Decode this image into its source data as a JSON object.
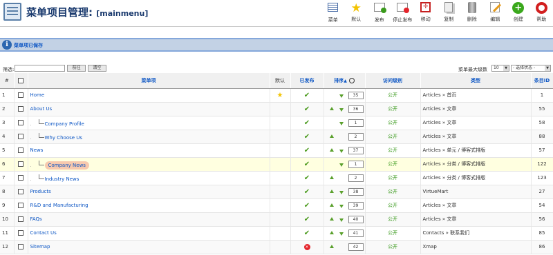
{
  "header": {
    "title": "菜单项目管理:",
    "menu_name": "[mainmenu]"
  },
  "toolbar": [
    {
      "name": "menu-button",
      "label": "菜单",
      "icon": "menu-icon",
      "color": "#4a6ea8"
    },
    {
      "name": "default-button",
      "label": "默认",
      "icon": "star-icon",
      "color": "#f3c300"
    },
    {
      "name": "publish-button",
      "label": "发布",
      "icon": "publish-icon",
      "color": "#3a9a1c"
    },
    {
      "name": "unpublish-button",
      "label": "停止发布",
      "icon": "unpublish-icon",
      "color": "#e4242b"
    },
    {
      "name": "move-button",
      "label": "移动",
      "icon": "move-icon",
      "color": "#c62020"
    },
    {
      "name": "copy-button",
      "label": "复制",
      "icon": "copy-icon",
      "color": "#888888"
    },
    {
      "name": "trash-button",
      "label": "删除",
      "icon": "trash-icon",
      "color": "#666666"
    },
    {
      "name": "edit-button",
      "label": "编辑",
      "icon": "edit-icon",
      "color": "#e59a1a"
    },
    {
      "name": "new-button",
      "label": "创建",
      "icon": "new-icon",
      "color": "#3aa81c"
    },
    {
      "name": "help-button",
      "label": "帮助",
      "icon": "help-icon",
      "color": "#d21f1f"
    }
  ],
  "message": {
    "text": "菜单项已保存"
  },
  "filter": {
    "label": "筛选:",
    "value": "",
    "go_label": "前往",
    "reset_label": "清空",
    "max_levels_label": "菜单最大级数",
    "max_levels_value": "10",
    "state_value": "- 选择状态 -"
  },
  "columns": {
    "num": "#",
    "title": "菜单项",
    "default": "默认",
    "published": "已发布",
    "order": "排序",
    "access": "访问级别",
    "type": "类型",
    "id": "条目ID"
  },
  "rows": [
    {
      "num": "1",
      "title": "Home",
      "level": 0,
      "default": true,
      "published": true,
      "order": "35",
      "up": false,
      "down": true,
      "access": "公开",
      "type": "Articles » 首页",
      "id": "1"
    },
    {
      "num": "2",
      "title": "About Us",
      "level": 0,
      "default": false,
      "published": true,
      "order": "36",
      "up": true,
      "down": true,
      "access": "公开",
      "type": "Articles » 文章",
      "id": "55"
    },
    {
      "num": "3",
      "title": "Company Profile",
      "level": 1,
      "default": false,
      "published": true,
      "order": "1",
      "up": false,
      "down": true,
      "access": "公开",
      "type": "Articles » 文章",
      "id": "58"
    },
    {
      "num": "4",
      "title": "Why Choose Us",
      "level": 1,
      "default": false,
      "published": true,
      "order": "2",
      "up": true,
      "down": false,
      "access": "公开",
      "type": "Articles » 文章",
      "id": "88"
    },
    {
      "num": "5",
      "title": "News",
      "level": 0,
      "default": false,
      "published": true,
      "order": "37",
      "up": true,
      "down": true,
      "access": "公开",
      "type": "Articles » 单元 / 博客式排版",
      "id": "57"
    },
    {
      "num": "6",
      "title": "Company News",
      "level": 1,
      "default": false,
      "published": true,
      "order": "1",
      "up": false,
      "down": true,
      "access": "公开",
      "type": "Articles » 分类 / 博客式排版",
      "id": "122",
      "highlight": true
    },
    {
      "num": "7",
      "title": "Industry News",
      "level": 1,
      "default": false,
      "published": true,
      "order": "2",
      "up": true,
      "down": false,
      "access": "公开",
      "type": "Articles » 分类 / 博客式排版",
      "id": "123"
    },
    {
      "num": "8",
      "title": "Products",
      "level": 0,
      "default": false,
      "published": true,
      "order": "38",
      "up": true,
      "down": true,
      "access": "公开",
      "type": "VirtueMart",
      "id": "27"
    },
    {
      "num": "9",
      "title": "R&D and Manufacturing",
      "level": 0,
      "default": false,
      "published": true,
      "order": "39",
      "up": true,
      "down": true,
      "access": "公开",
      "type": "Articles » 文章",
      "id": "54"
    },
    {
      "num": "10",
      "title": "FAQs",
      "level": 0,
      "default": false,
      "published": true,
      "order": "40",
      "up": true,
      "down": true,
      "access": "公开",
      "type": "Articles » 文章",
      "id": "56"
    },
    {
      "num": "11",
      "title": "Contact Us",
      "level": 0,
      "default": false,
      "published": true,
      "order": "41",
      "up": true,
      "down": true,
      "access": "公开",
      "type": "Contacts » 联系我们",
      "id": "85"
    },
    {
      "num": "12",
      "title": "Sitemap",
      "level": 0,
      "default": false,
      "published": false,
      "order": "42",
      "up": true,
      "down": false,
      "access": "公开",
      "type": "Xmap",
      "id": "86"
    }
  ]
}
